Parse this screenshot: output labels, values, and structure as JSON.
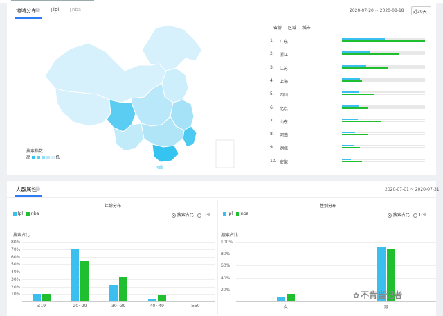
{
  "top_tabs": [
    "",
    "",
    "",
    "",
    ""
  ],
  "region": {
    "title": "地域分布",
    "series_tabs": [
      "lpl",
      "nba"
    ],
    "date_range": "2020-07-20 ~ 2020-08-18",
    "range_select": "近30天",
    "sub_tabs": [
      "省份",
      "区域",
      "城市"
    ],
    "legend_title": "搜索指数",
    "legend_high": "高",
    "legend_low": "低",
    "ranking": [
      {
        "rank": "1.",
        "name": "广东",
        "blue": 0.52,
        "green": 1.0
      },
      {
        "rank": "2.",
        "name": "浙江",
        "blue": 0.33,
        "green": 0.68
      },
      {
        "rank": "3.",
        "name": "江苏",
        "blue": 0.29,
        "green": 0.55
      },
      {
        "rank": "4.",
        "name": "上海",
        "blue": 0.22,
        "green": 0.24
      },
      {
        "rank": "5.",
        "name": "四川",
        "blue": 0.21,
        "green": 0.38
      },
      {
        "rank": "6.",
        "name": "北京",
        "blue": 0.2,
        "green": 0.32
      },
      {
        "rank": "7.",
        "name": "山东",
        "blue": 0.19,
        "green": 0.47
      },
      {
        "rank": "8.",
        "name": "河南",
        "blue": 0.16,
        "green": 0.31
      },
      {
        "rank": "9.",
        "name": "湖北",
        "blue": 0.15,
        "green": 0.22
      },
      {
        "rank": "10.",
        "name": "安徽",
        "blue": 0.11,
        "green": 0.24
      }
    ],
    "colors": {
      "blue": "#3bbfef",
      "green": "#1fbf2f",
      "map_base": "#d6f1fc",
      "map_mid": "#a6e2f7",
      "map_high": "#3fc8f2"
    }
  },
  "crowd": {
    "title": "人群属性",
    "date_range": "2020-07-01 ~ 2020-07-31",
    "radio_a": "搜索占比",
    "radio_b": "TGI",
    "legend_lpl": "lpl",
    "legend_nba": "nba",
    "ylabel": "搜索占比"
  },
  "chart_data": [
    {
      "type": "bar",
      "title": "年龄分布",
      "ylabel": "搜索占比",
      "ylim": [
        0,
        80
      ],
      "yticks": [
        "80%",
        "70%",
        "60%",
        "50%",
        "40%",
        "30%",
        "20%",
        "10%"
      ],
      "categories": [
        "≤19",
        "20~29",
        "30~39",
        "40~49",
        "≥50"
      ],
      "series": [
        {
          "name": "lpl",
          "color": "#3bbfef",
          "values": [
            10,
            70,
            22,
            4,
            1
          ]
        },
        {
          "name": "nba",
          "color": "#1fbf2f",
          "values": [
            10,
            54,
            33,
            9,
            1
          ]
        }
      ]
    },
    {
      "type": "bar",
      "title": "性别分布",
      "ylabel": "搜索占比",
      "ylim": [
        0,
        100
      ],
      "yticks": [
        "100%",
        "80%",
        "60%",
        "40%",
        "20%"
      ],
      "categories": [
        "女",
        "男"
      ],
      "series": [
        {
          "name": "lpl",
          "color": "#3bbfef",
          "values": [
            8,
            92
          ]
        },
        {
          "name": "nba",
          "color": "#1fbf2f",
          "values": [
            13,
            88
          ]
        }
      ]
    }
  ],
  "watermark": "不肯当记者"
}
